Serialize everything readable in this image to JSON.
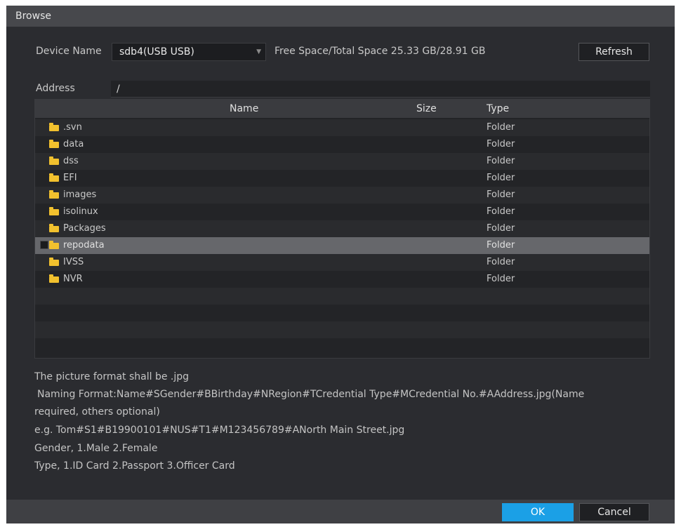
{
  "window": {
    "title": "Browse"
  },
  "device": {
    "label": "Device Name",
    "selected": "sdb4(USB USB)",
    "space_label": "Free Space/Total Space 25.33 GB/28.91 GB",
    "refresh_label": "Refresh"
  },
  "address": {
    "label": "Address",
    "value": "/"
  },
  "table": {
    "columns": {
      "name": "Name",
      "size": "Size",
      "type": "Type"
    },
    "rows": [
      {
        "name": ".svn",
        "size": "",
        "type": "Folder"
      },
      {
        "name": "data",
        "size": "",
        "type": "Folder"
      },
      {
        "name": "dss",
        "size": "",
        "type": "Folder"
      },
      {
        "name": "EFI",
        "size": "",
        "type": "Folder"
      },
      {
        "name": "images",
        "size": "",
        "type": "Folder"
      },
      {
        "name": "isolinux",
        "size": "",
        "type": "Folder"
      },
      {
        "name": "Packages",
        "size": "",
        "type": "Folder"
      },
      {
        "name": "repodata",
        "size": "",
        "type": "Folder"
      },
      {
        "name": "IVSS",
        "size": "",
        "type": "Folder"
      },
      {
        "name": "NVR",
        "size": "",
        "type": "Folder"
      }
    ],
    "selected_row": "repodata"
  },
  "info": {
    "line1": "The picture format shall be .jpg",
    "line2": "Naming Format:Name#SGender#BBirthday#NRegion#TCredential Type#MCredential No.#AAddress.jpg(Name",
    "line3": "required, others optional)",
    "line4": "e.g. Tom#S1#B19900101#NUS#T1#M123456789#ANorth Main Street.jpg",
    "line5": "Gender, 1.Male 2.Female",
    "line6": "Type, 1.ID Card 2.Passport 3.Officer Card"
  },
  "footer": {
    "ok_label": "OK",
    "cancel_label": "Cancel"
  },
  "icons": {
    "folder": "folder-icon",
    "dropdown": "chevron-down-icon"
  },
  "colors": {
    "accent": "#1ba0e6",
    "folder": "#f2c12e",
    "background": "#2b2c30"
  }
}
